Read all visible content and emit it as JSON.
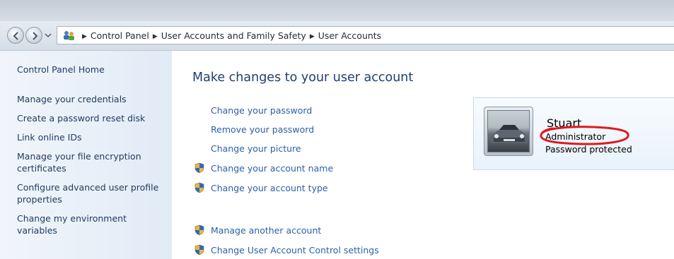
{
  "breadcrumbs": [
    "Control Panel",
    "User Accounts and Family Safety",
    "User Accounts"
  ],
  "sidebar": {
    "home": "Control Panel Home",
    "items": [
      {
        "label": "Manage your credentials"
      },
      {
        "label": "Create a password reset disk"
      },
      {
        "label": "Link online IDs"
      },
      {
        "label": "Manage your file encryption certificates"
      },
      {
        "label": "Configure advanced user profile properties"
      },
      {
        "label": "Change my environment variables"
      }
    ]
  },
  "main": {
    "title": "Make changes to your user account",
    "tasks": [
      {
        "label": "Change your password",
        "shield": false
      },
      {
        "label": "Remove your password",
        "shield": false
      },
      {
        "label": "Change your picture",
        "shield": false
      },
      {
        "label": "Change your account name",
        "shield": true
      },
      {
        "label": "Change your account type",
        "shield": true
      },
      {
        "label": "Manage another account",
        "shield": true
      },
      {
        "label": "Change User Account Control settings",
        "shield": true
      }
    ]
  },
  "account": {
    "name": "Stuart",
    "role": "Administrator",
    "status": "Password protected"
  },
  "colors": {
    "link": "#2b5fa8",
    "sidebar_link": "#1e3a5f",
    "title": "#1f3f6e",
    "highlight_ring": "#e0191f"
  },
  "icons": [
    "back-icon",
    "forward-icon",
    "chevron-down-icon",
    "control-panel-icon",
    "uac-shield-icon"
  ]
}
